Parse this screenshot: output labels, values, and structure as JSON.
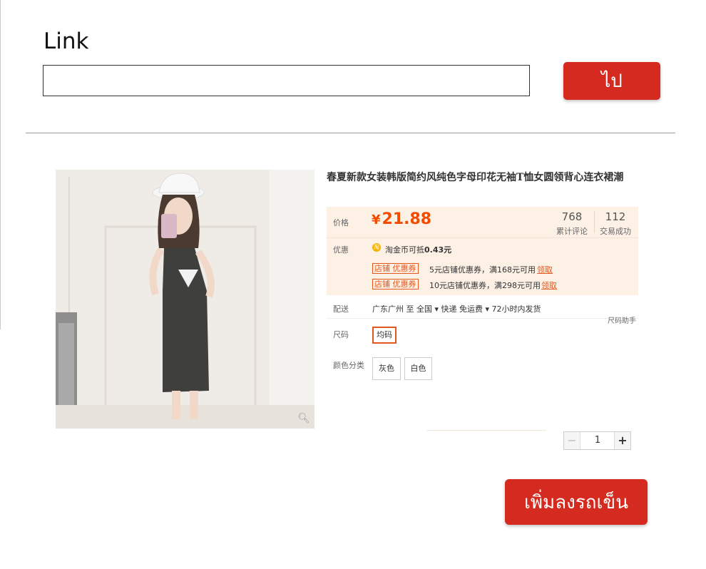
{
  "form": {
    "link_label": "Link",
    "link_value": "",
    "go_label": "ไป"
  },
  "product": {
    "title": "春夏新款女装韩版简约风纯色字母印花无袖T恤女圆领背心连衣裙潮",
    "price_label": "价格",
    "currency_symbol": "¥",
    "price": "21.88",
    "reviews_count": "768",
    "reviews_label": "累计评论",
    "sales_count": "112",
    "sales_label": "交易成功",
    "promo_label": "优惠",
    "coin_icon_glyph": "淘",
    "coin_text": "淘金币可抵",
    "coin_amount": "0.43元",
    "coupons": [
      {
        "tag": "店铺 优惠券",
        "text": "5元店铺优惠券，满168元可用",
        "link": "领取"
      },
      {
        "tag": "店铺 优惠券",
        "text": "10元店铺优惠券，满298元可用",
        "link": "领取"
      }
    ],
    "shipping_label": "配送",
    "shipping_text": "广东广州 至  全国 ▾   快递 免运费 ▾   72小时内发货",
    "size_helper": "尺码助手",
    "size_label": "尺码",
    "size_option": "均码",
    "color_label": "颜色分类",
    "color_options": [
      "灰色",
      "白色"
    ],
    "quantity": "1",
    "qty_minus": "−",
    "qty_plus": "+"
  },
  "actions": {
    "add_to_cart_label": "เพิ่มลงรถเข็น"
  },
  "colors": {
    "brand_red": "#d42a1f",
    "price_orange": "#f24b00",
    "promo_bg": "#fdf1e6"
  }
}
